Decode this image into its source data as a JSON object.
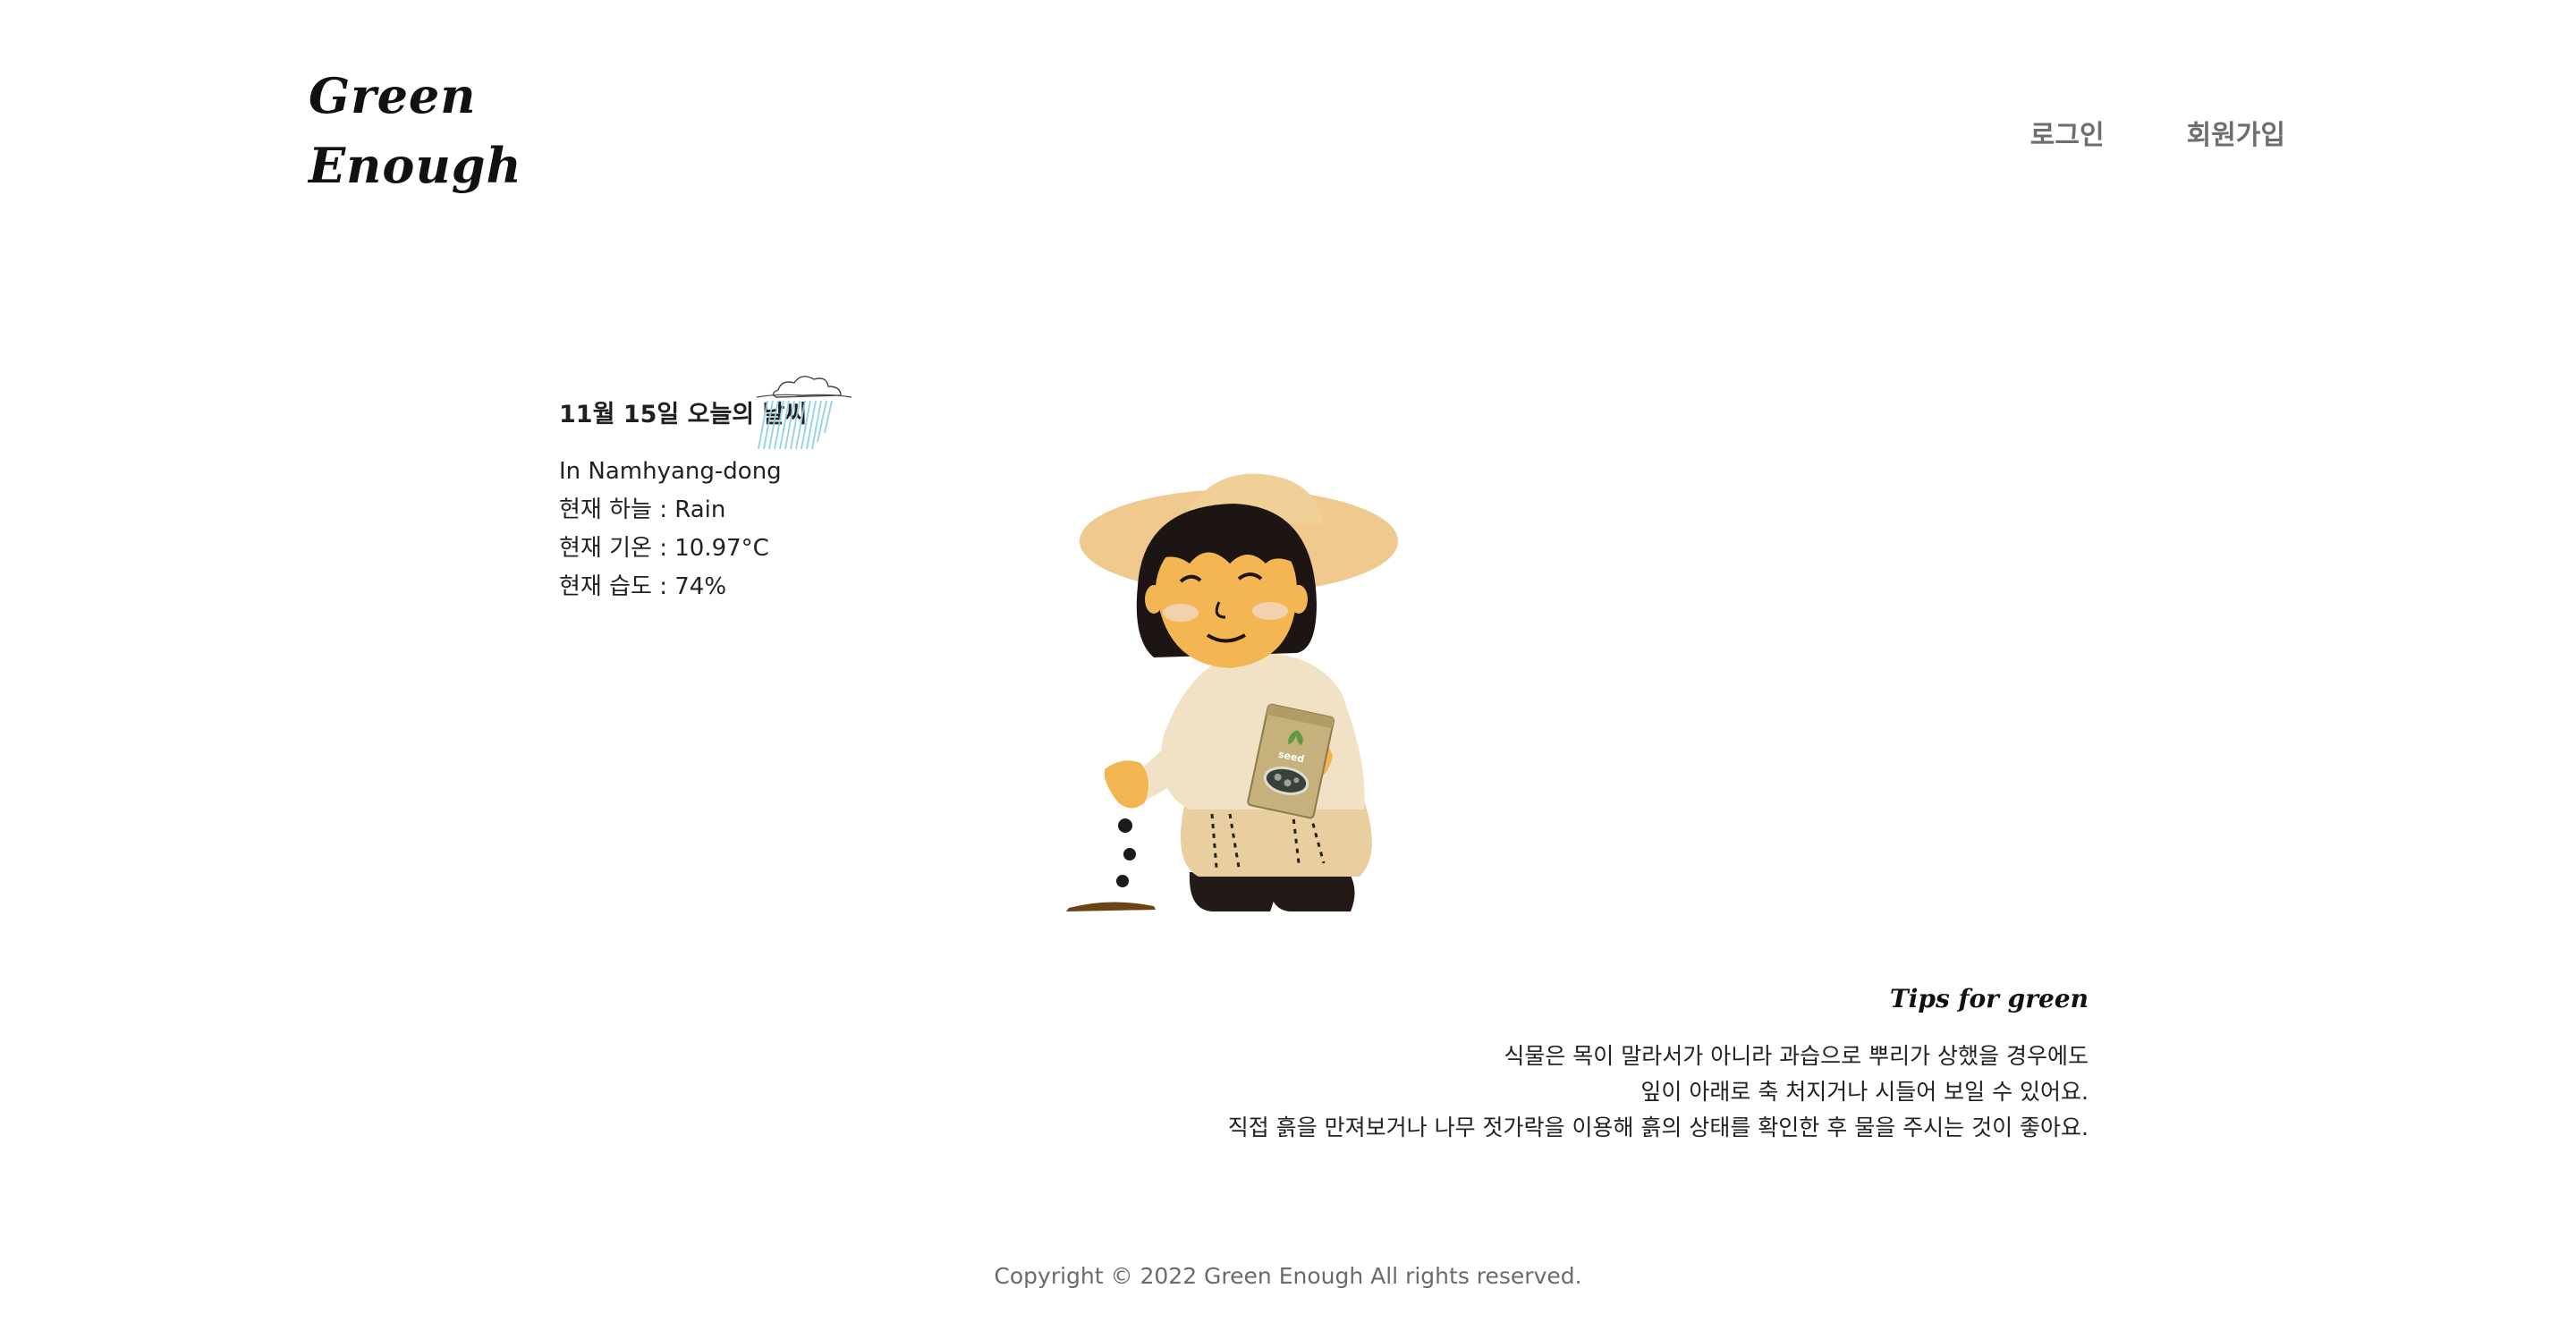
{
  "header": {
    "logo_line1": "Green",
    "logo_line2": "Enough",
    "nav": {
      "login": "로그인",
      "signup": "회원가입"
    }
  },
  "weather": {
    "title": "11월 15일 오늘의 날씨",
    "location": "In Namhyang-dong",
    "sky": "현재 하늘 : Rain",
    "temperature": "현재 기온 : 10.97°C",
    "humidity": "현재 습도 : 74%",
    "icon": "rain-cloud-icon"
  },
  "tips": {
    "title": "Tips for green",
    "lines": [
      "식물은 목이 말라서가 아니라 과습으로 뿌리가 상했을 경우에도",
      "잎이 아래로 축 처지거나 시들어 보일 수 있어요.",
      "직접 흙을 만져보거나 나무 젓가락을 이용해 흙의 상태를 확인한 후 물을 주시는 것이 좋아요."
    ]
  },
  "illustration": {
    "seed_pack_label": "seed"
  },
  "footer": {
    "copyright": "Copyright © 2022 Green Enough All rights reserved."
  }
}
